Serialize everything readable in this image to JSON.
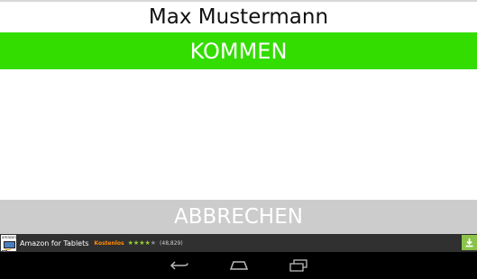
{
  "header": {
    "user_name": "Max Mustermann"
  },
  "actions": {
    "kommen_label": "KOMMEN",
    "abbrechen_label": "ABBRECHEN"
  },
  "ad": {
    "title": "Amazon for Tablets",
    "price": "Kostenlos",
    "rating_stars": 4,
    "rating_max": 5,
    "reviews": "(48,829)",
    "logo_icon": "amazon-app-icon",
    "download_icon": "download-icon",
    "info_icon": "ad-info-icon"
  },
  "nav": {
    "icons": [
      "back-icon",
      "home-icon",
      "recents-icon"
    ]
  },
  "colors": {
    "kommen_bg": "#33dd00",
    "abbrechen_bg": "#cccccc",
    "ad_bg": "#303030",
    "nav_bg": "#000000"
  }
}
